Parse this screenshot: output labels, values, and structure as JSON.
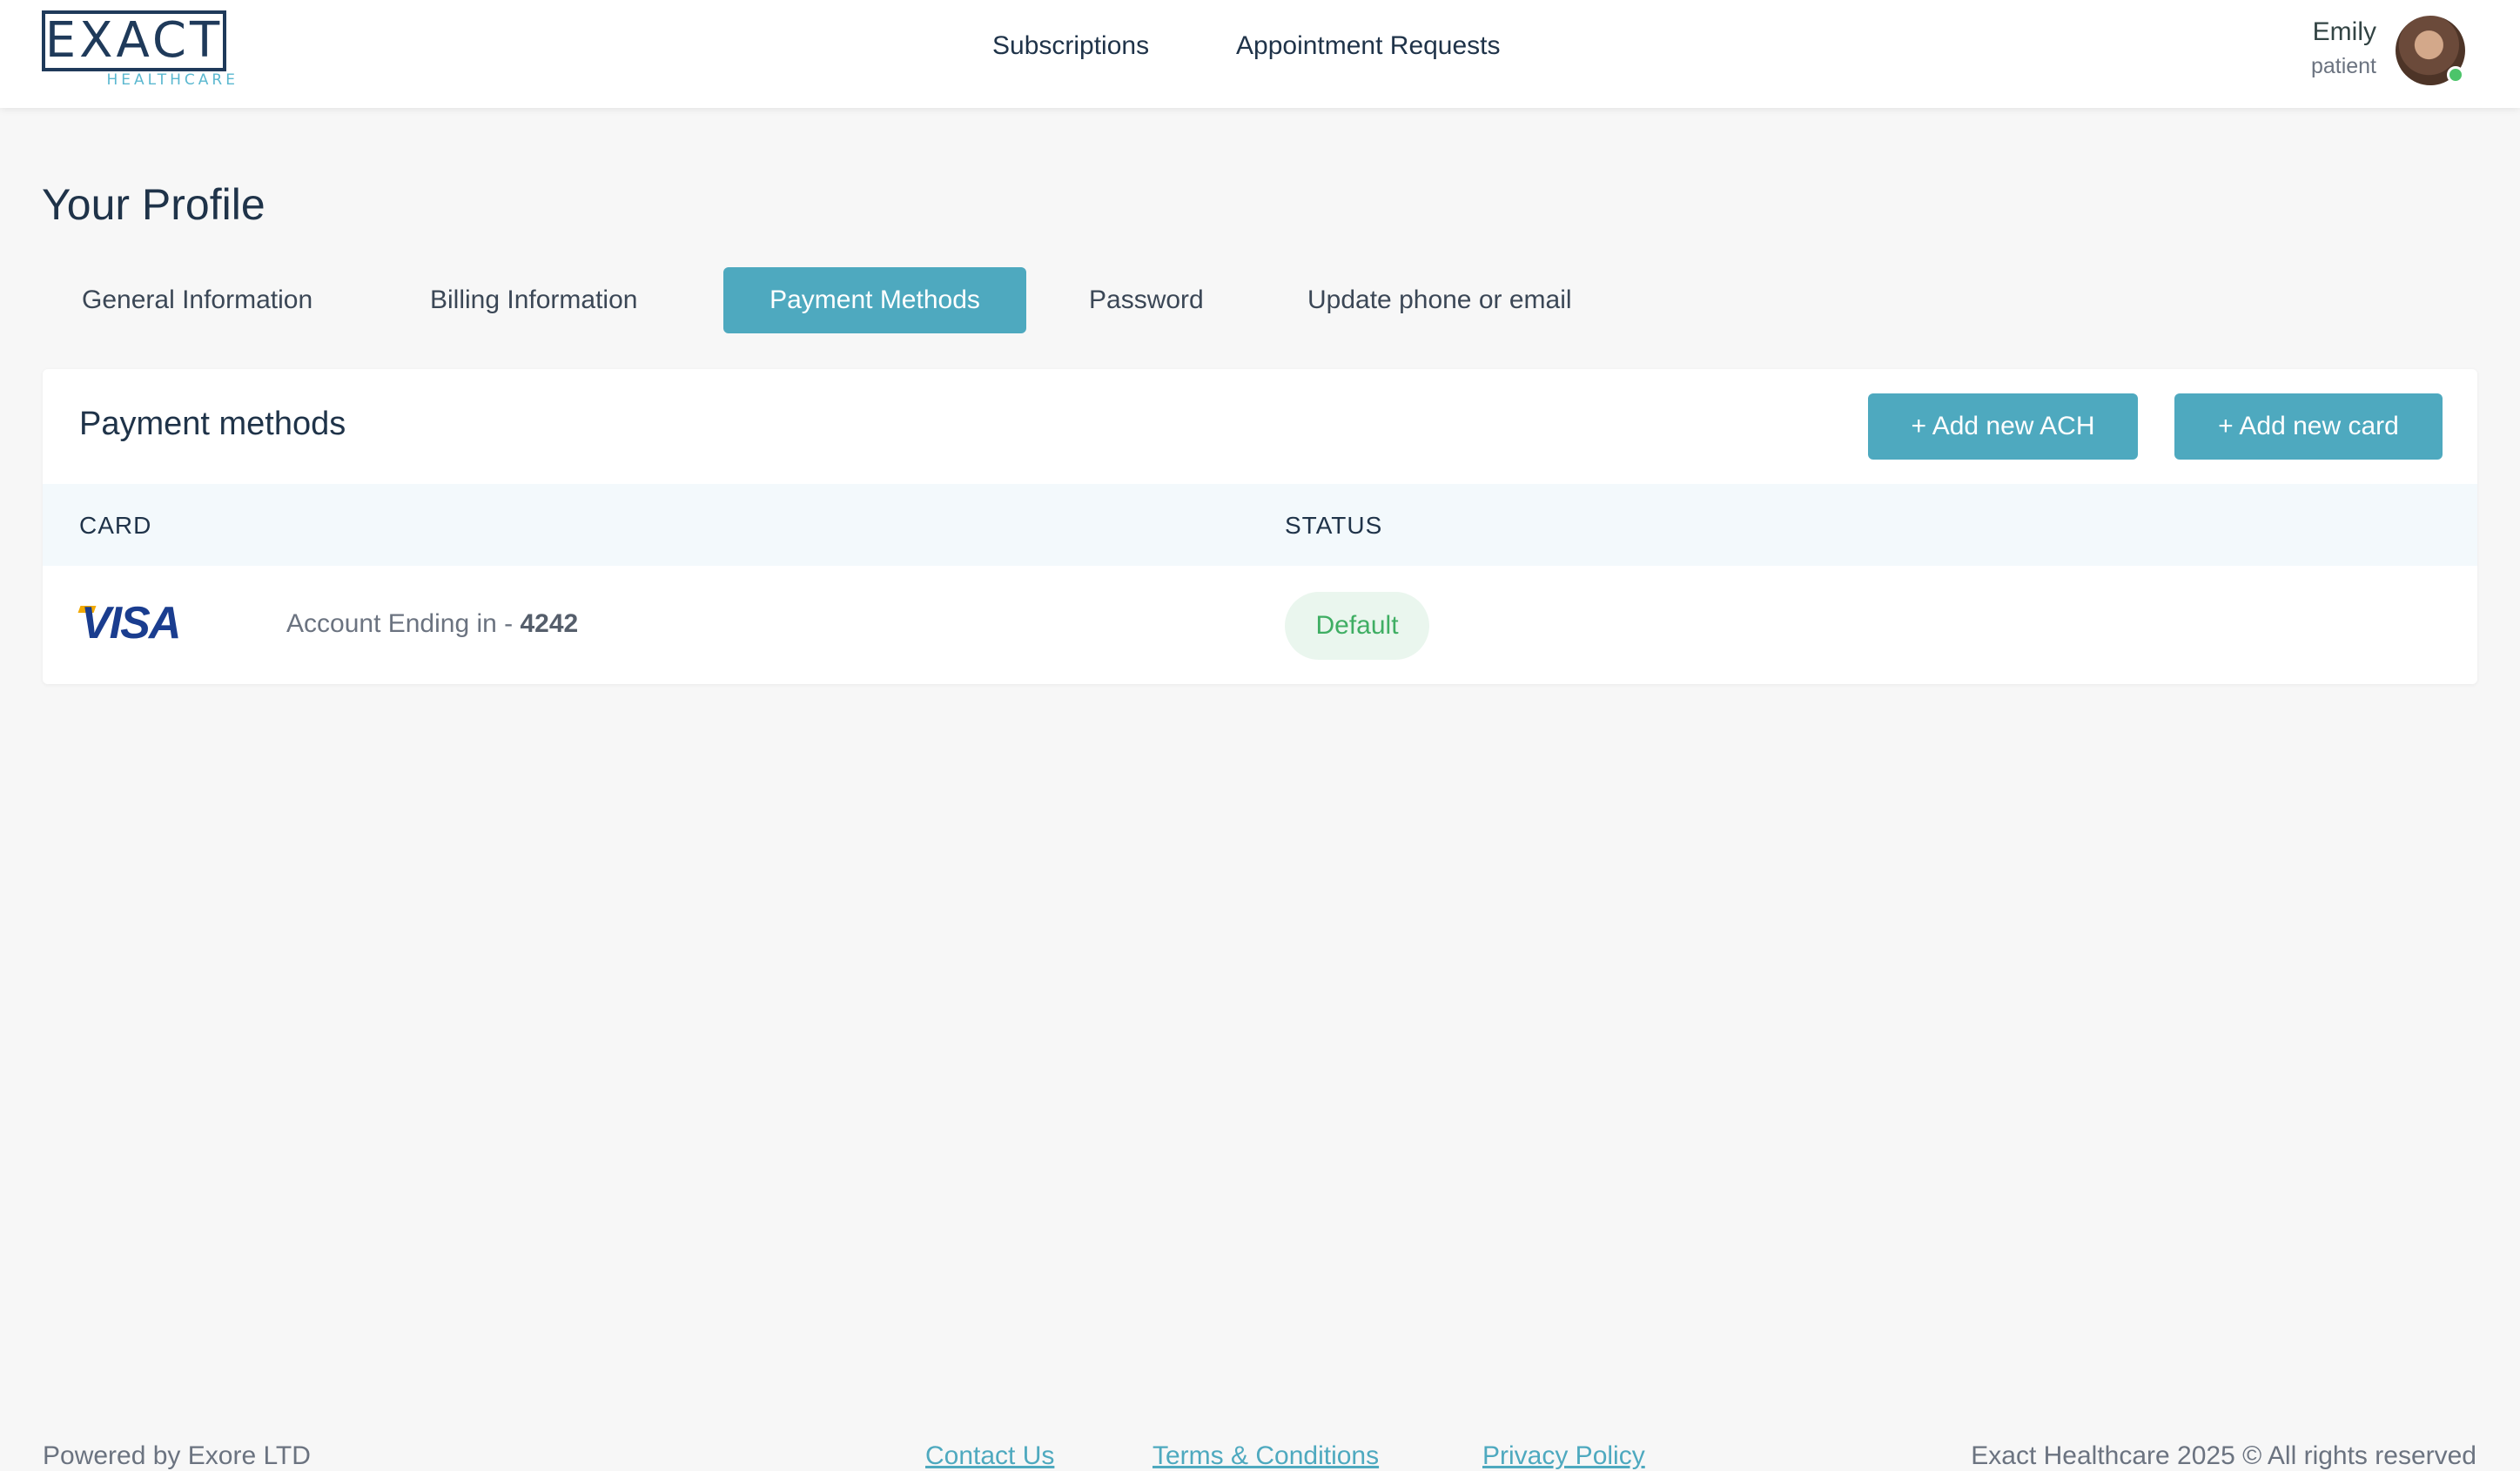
{
  "header": {
    "logo": {
      "main": "EXACT",
      "sub": "HEALTHCARE"
    },
    "nav": [
      {
        "label": "Subscriptions"
      },
      {
        "label": "Appointment Requests"
      }
    ],
    "user": {
      "name": "Emily",
      "role": "patient",
      "status": "online"
    }
  },
  "page": {
    "title": "Your Profile"
  },
  "tabs": [
    {
      "label": "General Information",
      "active": false
    },
    {
      "label": "Billing Information",
      "active": false
    },
    {
      "label": "Payment Methods",
      "active": true
    },
    {
      "label": "Password",
      "active": false
    },
    {
      "label": "Update phone or email",
      "active": false
    }
  ],
  "payment_methods": {
    "title": "Payment methods",
    "buttons": {
      "add_ach": "+ Add new ACH",
      "add_card": "+ Add new card"
    },
    "columns": {
      "card": "CARD",
      "status": "STATUS"
    },
    "rows": [
      {
        "brand": "VISA",
        "account_prefix": "Account Ending in - ",
        "last4": "4242",
        "status": "Default"
      }
    ]
  },
  "footer": {
    "powered_by": "Powered by Exore LTD",
    "links": [
      "Contact Us",
      "Terms & Conditions",
      "Privacy Policy"
    ],
    "copyright": "Exact Healthcare 2025 © All rights reserved"
  },
  "colors": {
    "accent": "#4ea9bf",
    "brand_navy": "#1f3a5a",
    "status_green": "#3fae63"
  }
}
